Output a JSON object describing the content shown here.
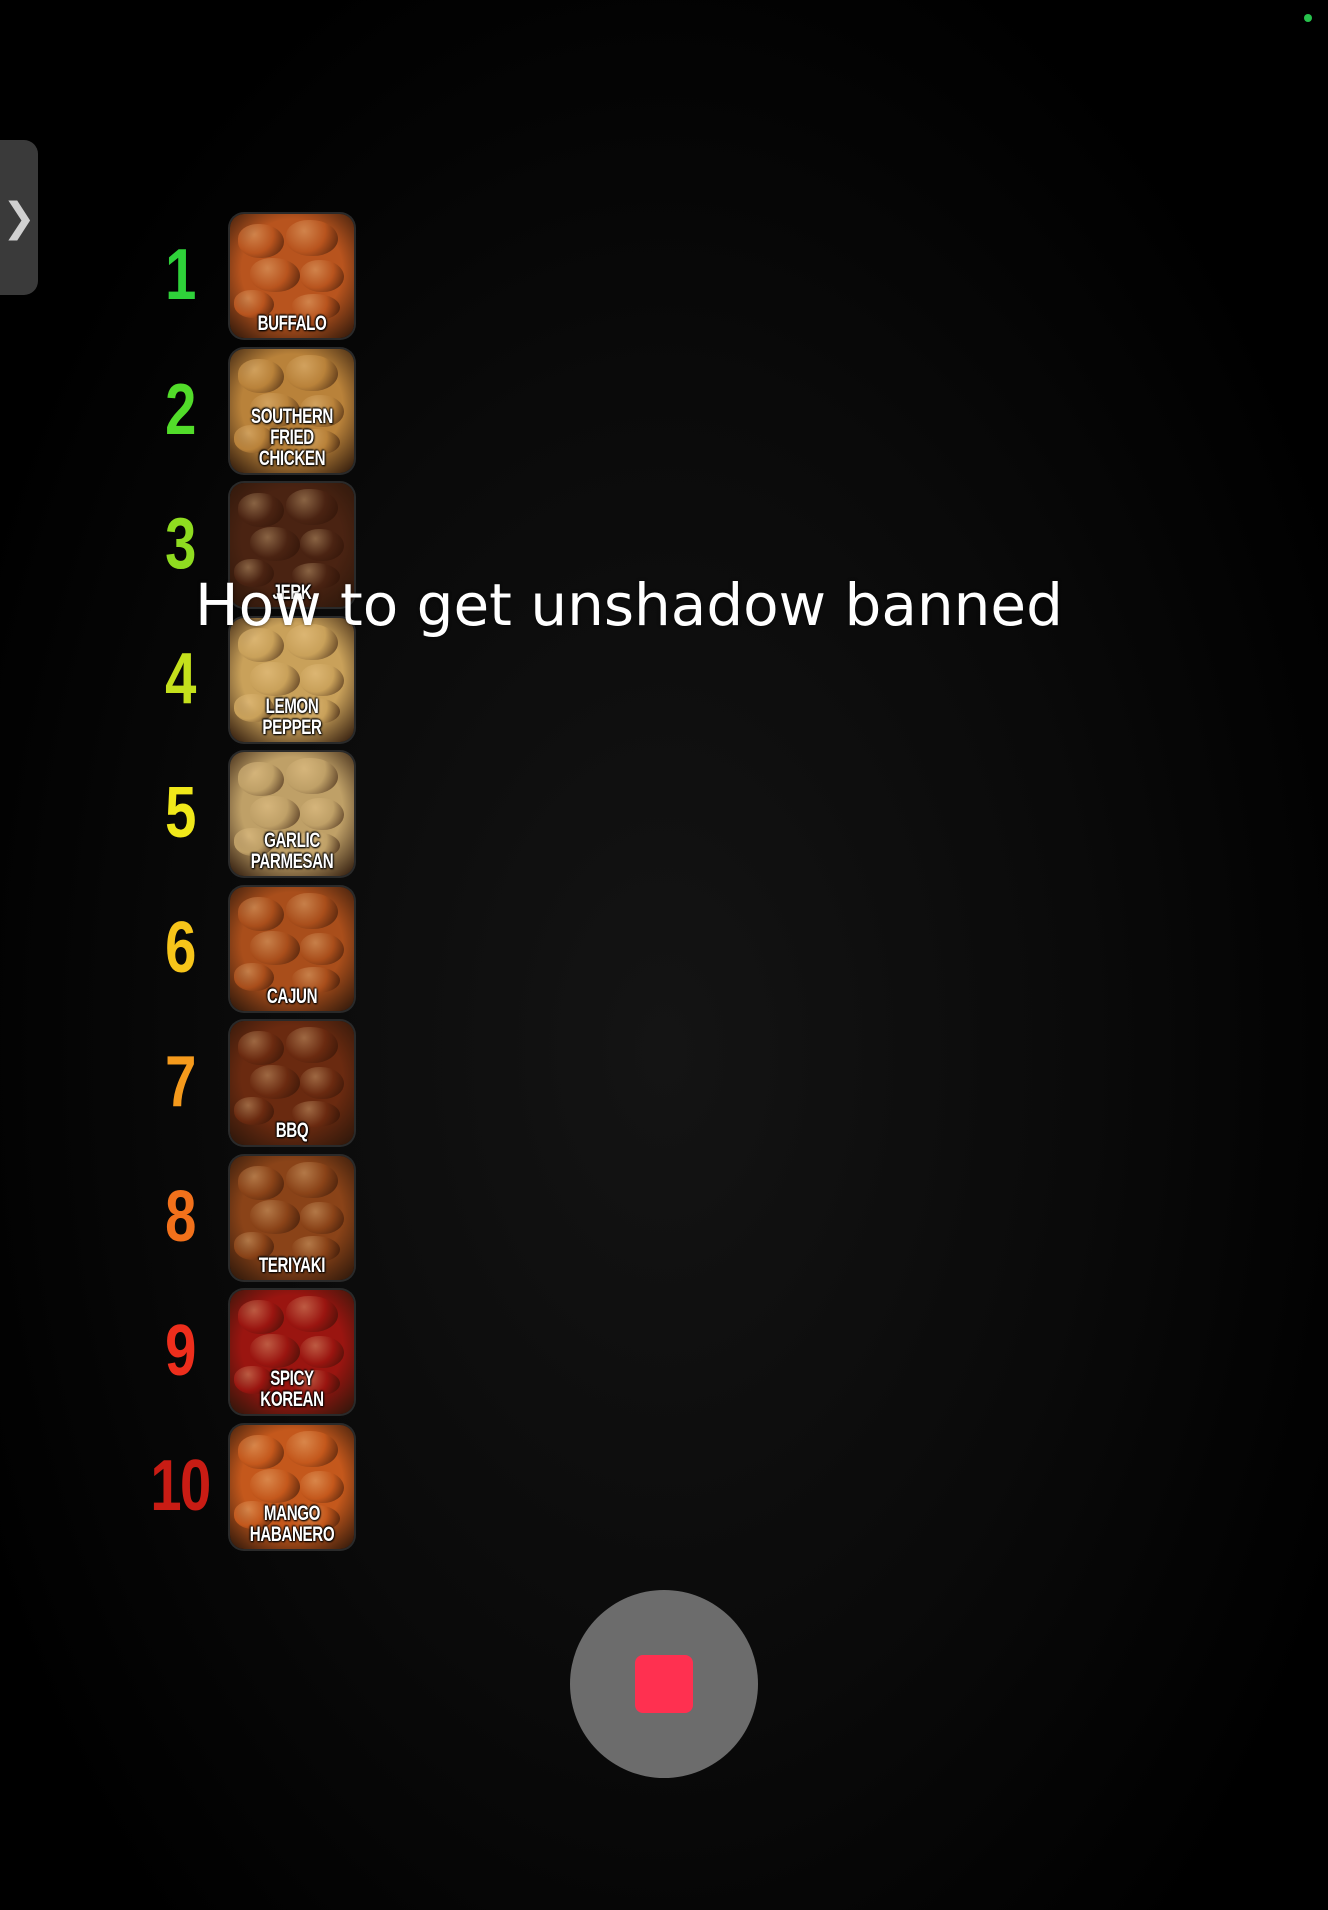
{
  "overlay": {
    "caption": "How to get unshadow banned",
    "handle_icon": "chevron-right-icon",
    "handle_glyph": "❯"
  },
  "tier_list": [
    {
      "rank": "1",
      "label": "BUFFALO",
      "rank_color": "#2fd23a",
      "food_color": "#b8541e"
    },
    {
      "rank": "2",
      "label": "SOUTHERN\nFRIED CHICKEN",
      "rank_color": "#52dc2a",
      "food_color": "#b9823a"
    },
    {
      "rank": "3",
      "label": "JERK",
      "rank_color": "#8fdc20",
      "food_color": "#4a2312"
    },
    {
      "rank": "4",
      "label": "LEMON PEPPER",
      "rank_color": "#c4e01c",
      "food_color": "#c9a15a"
    },
    {
      "rank": "5",
      "label": "GARLIC\nPARMESAN",
      "rank_color": "#f0e81a",
      "food_color": "#bfa067"
    },
    {
      "rank": "6",
      "label": "CAJUN",
      "rank_color": "#f7c51a",
      "food_color": "#a94e1b"
    },
    {
      "rank": "7",
      "label": "BBQ",
      "rank_color": "#f59a1c",
      "food_color": "#6a2a10"
    },
    {
      "rank": "8",
      "label": "TERIYAKI",
      "rank_color": "#f2711b",
      "food_color": "#8a4318"
    },
    {
      "rank": "9",
      "label": "SPICY KOREAN",
      "rank_color": "#ee2e1c",
      "food_color": "#9a1510"
    },
    {
      "rank": "10",
      "label": "MANGO\nHABANERO",
      "rank_color": "#c91c14",
      "food_color": "#c4581c"
    }
  ],
  "controls": {
    "record_button_icon": "stop-icon",
    "stop_color": "#ff3050",
    "status_indicator_color": "#27c24c"
  }
}
